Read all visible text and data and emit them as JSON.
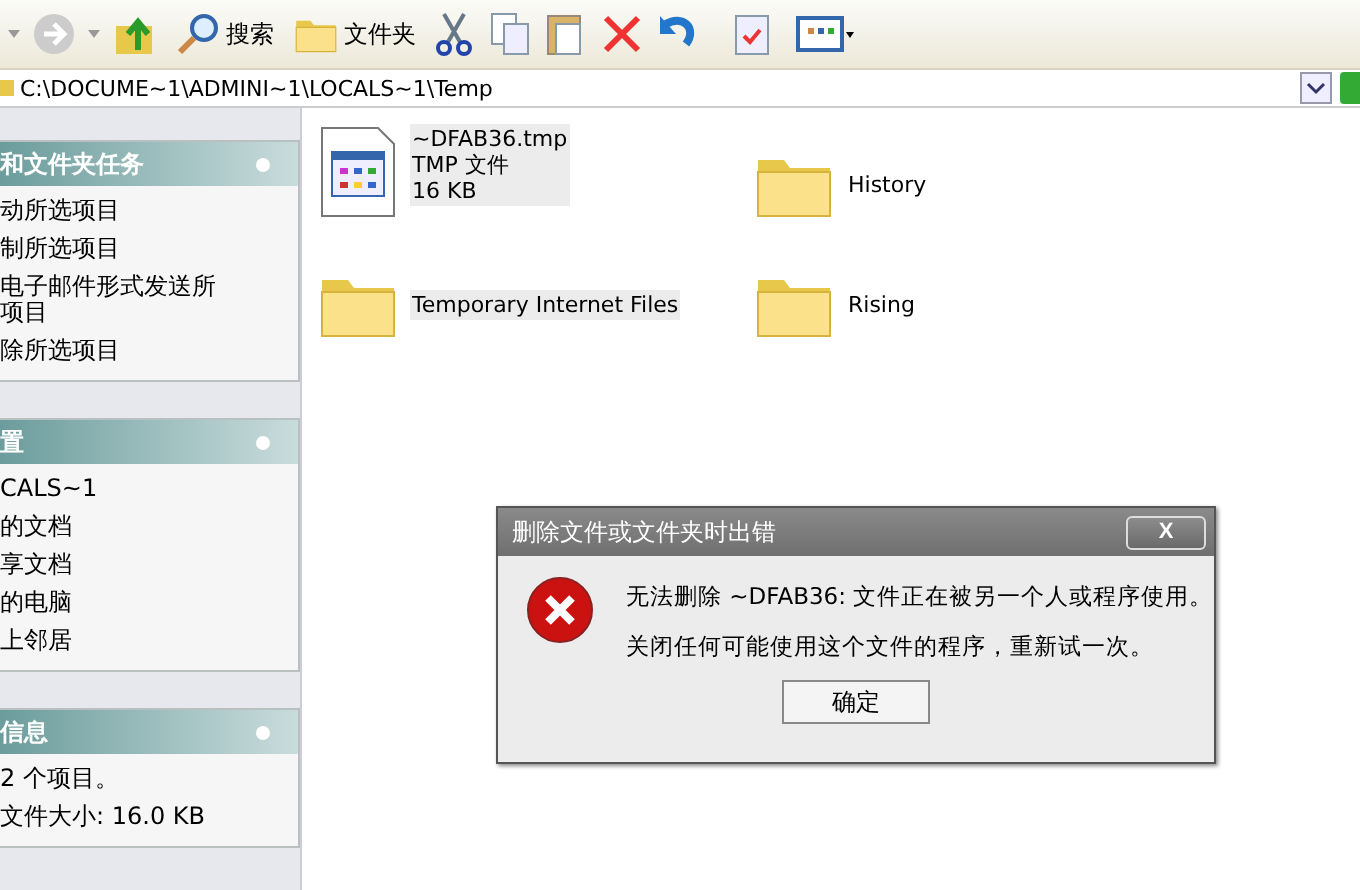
{
  "toolbar": {
    "search_label": "搜索",
    "folders_label": "文件夹"
  },
  "address": {
    "path": "C:\\DOCUME~1\\ADMINI~1\\LOCALS~1\\Temp"
  },
  "panels": [
    {
      "title": "和文件夹任务",
      "items": [
        "动所选项目",
        "制所选项目",
        "电子邮件形式发送所项目",
        "除所选项目"
      ]
    },
    {
      "title": "置",
      "items": [
        "CALS~1",
        "的文档",
        "享文档",
        "的电脑",
        "上邻居"
      ]
    },
    {
      "title": "信息",
      "items": [
        "2 个项目。",
        "文件大小: 16.0 KB"
      ]
    }
  ],
  "files": [
    {
      "kind": "file",
      "name": "~DFAB36.tmp",
      "type": "TMP 文件",
      "size": "16 KB",
      "selected": true
    },
    {
      "kind": "folder",
      "name": "History",
      "selected": false
    },
    {
      "kind": "folder",
      "name": "Temporary Internet Files",
      "selected": true
    },
    {
      "kind": "folder",
      "name": "Rising",
      "selected": false
    }
  ],
  "dialog": {
    "title": "删除文件或文件夹时出错",
    "close": "X",
    "message": "无法删除 ~DFAB36: 文件正在被另一个人或程序使用。",
    "hint": "关闭任何可能使用这个文件的程序，重新试一次。",
    "button": "确定"
  }
}
